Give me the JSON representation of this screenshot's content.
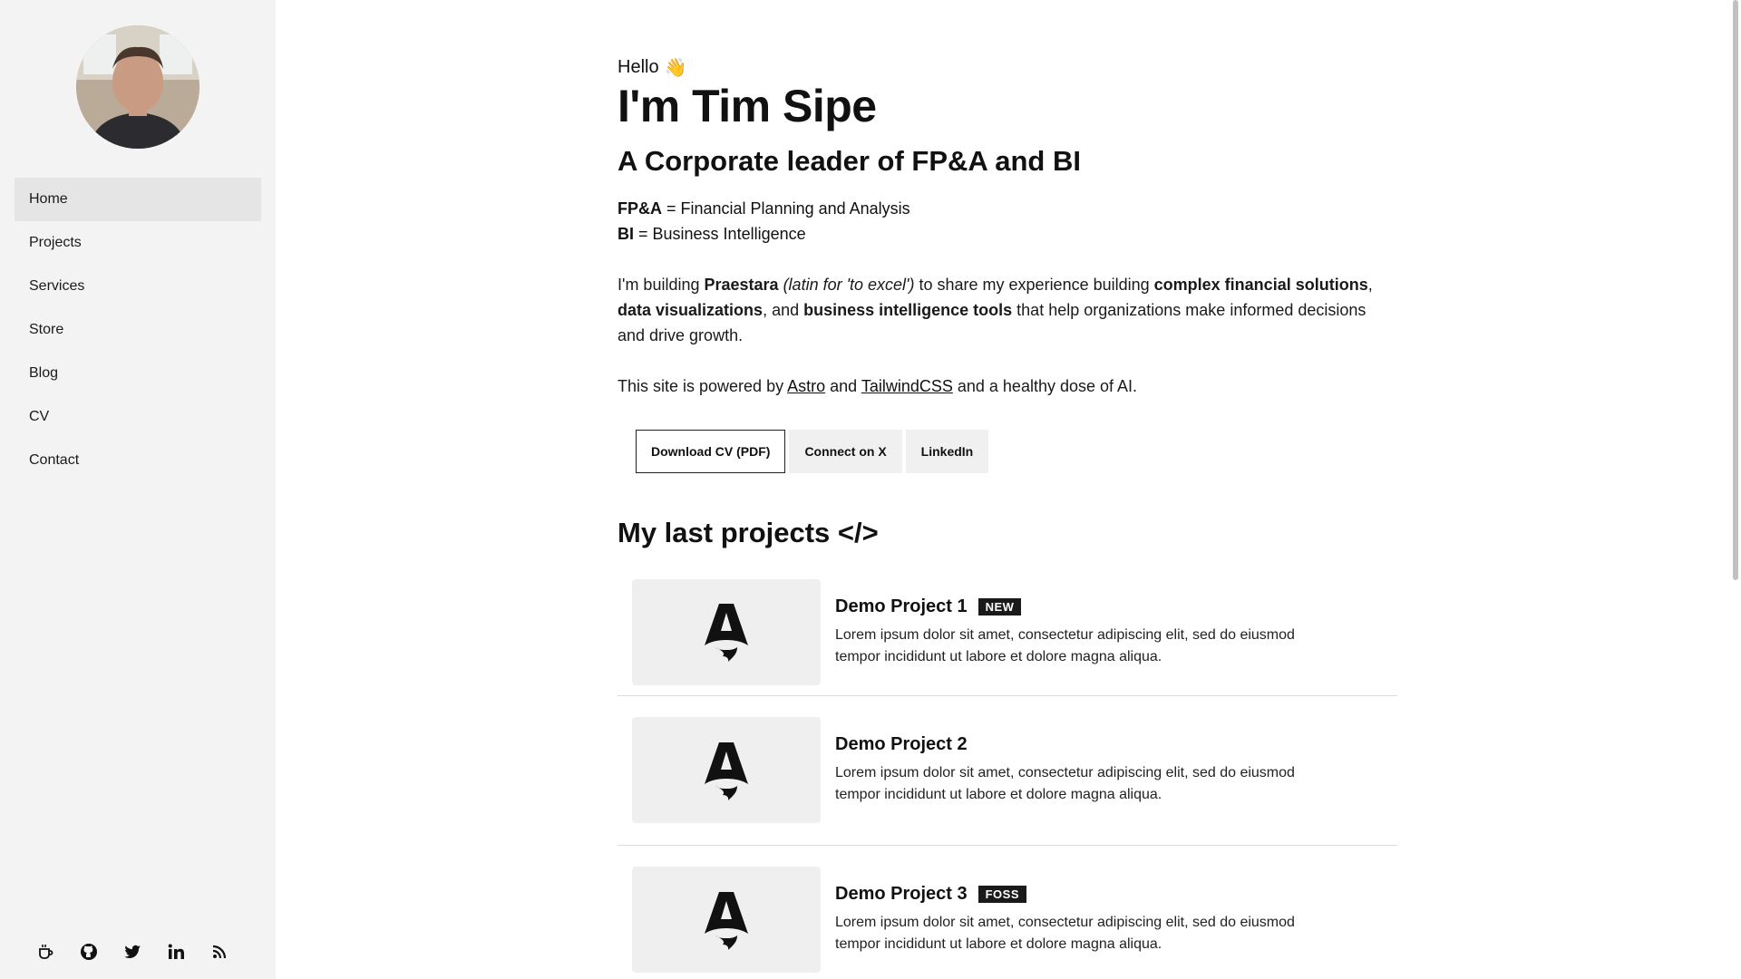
{
  "sidebar": {
    "nav": [
      {
        "label": "Home",
        "active": true
      },
      {
        "label": "Projects",
        "active": false
      },
      {
        "label": "Services",
        "active": false
      },
      {
        "label": "Store",
        "active": false
      },
      {
        "label": "Blog",
        "active": false
      },
      {
        "label": "CV",
        "active": false
      },
      {
        "label": "Contact",
        "active": false
      }
    ],
    "socials": [
      "coffee-icon",
      "github-icon",
      "twitter-icon",
      "linkedin-icon",
      "rss-icon"
    ]
  },
  "hero": {
    "greeting": "Hello",
    "wave": "👋",
    "name": "I'm Tim Sipe",
    "tagline": "A Corporate leader of FP&A and BI",
    "defs": [
      {
        "abbr": "FP&A",
        "meaning": " = Financial Planning and Analysis"
      },
      {
        "abbr": "BI",
        "meaning": " = Business Intelligence"
      }
    ],
    "intro": {
      "p1": "I'm building ",
      "brand": "Praestara",
      "brand_note": " (latin for 'to excel')",
      "p2": " to share my experience building ",
      "b1": "complex financial solutions",
      "p3": ", ",
      "b2": "data visualizations",
      "p4": ", and ",
      "b3": "business intelligence tools",
      "p5": " that help organizations make informed decisions and drive growth."
    },
    "powered": {
      "p1": "This site is powered by ",
      "link1": "Astro",
      "p2": " and ",
      "link2": "TailwindCSS",
      "p3": " and a healthy dose of AI."
    },
    "buttons": {
      "cv": "Download CV (PDF)",
      "x": "Connect on X",
      "linkedin": "LinkedIn"
    }
  },
  "projects_section": {
    "title": "My last projects </>",
    "items": [
      {
        "title": "Demo Project 1",
        "badge": "NEW",
        "desc": "Lorem ipsum dolor sit amet, consectetur adipiscing elit, sed do eiusmod tempor incididunt ut labore et dolore magna aliqua."
      },
      {
        "title": "Demo Project 2",
        "badge": "",
        "desc": "Lorem ipsum dolor sit amet, consectetur adipiscing elit, sed do eiusmod tempor incididunt ut labore et dolore magna aliqua."
      },
      {
        "title": "Demo Project 3",
        "badge": "FOSS",
        "desc": "Lorem ipsum dolor sit amet, consectetur adipiscing elit, sed do eiusmod tempor incididunt ut labore et dolore magna aliqua."
      }
    ]
  },
  "colors": {
    "sidebar_bg": "#f3f3f3",
    "active_nav_bg": "#e5e5e5",
    "badge_bg": "#1a1a1a",
    "thumb_bg": "#efefef"
  }
}
